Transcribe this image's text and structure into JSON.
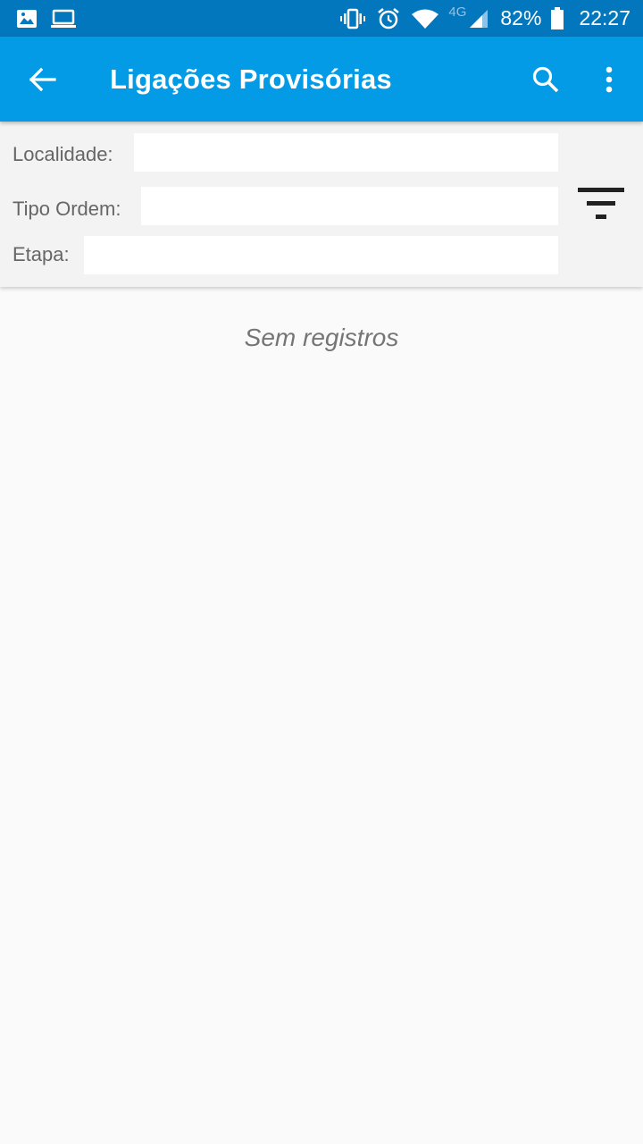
{
  "status_bar": {
    "battery": "82%",
    "time": "22:27",
    "network": "4G",
    "icons": [
      "image-icon",
      "laptop-icon",
      "vibrate-icon",
      "alarm-icon",
      "wifi-icon",
      "signal-icon",
      "battery-icon"
    ]
  },
  "app_bar": {
    "title": "Ligações Provisórias",
    "background": "#039be5",
    "status_background": "#0277bd"
  },
  "filters": {
    "localidade_label": "Localidade:",
    "localidade_value": "",
    "tipo_ordem_label": "Tipo Ordem:",
    "tipo_ordem_value": "",
    "etapa_label": "Etapa:",
    "etapa_value": ""
  },
  "content": {
    "empty_message": "Sem registros"
  }
}
